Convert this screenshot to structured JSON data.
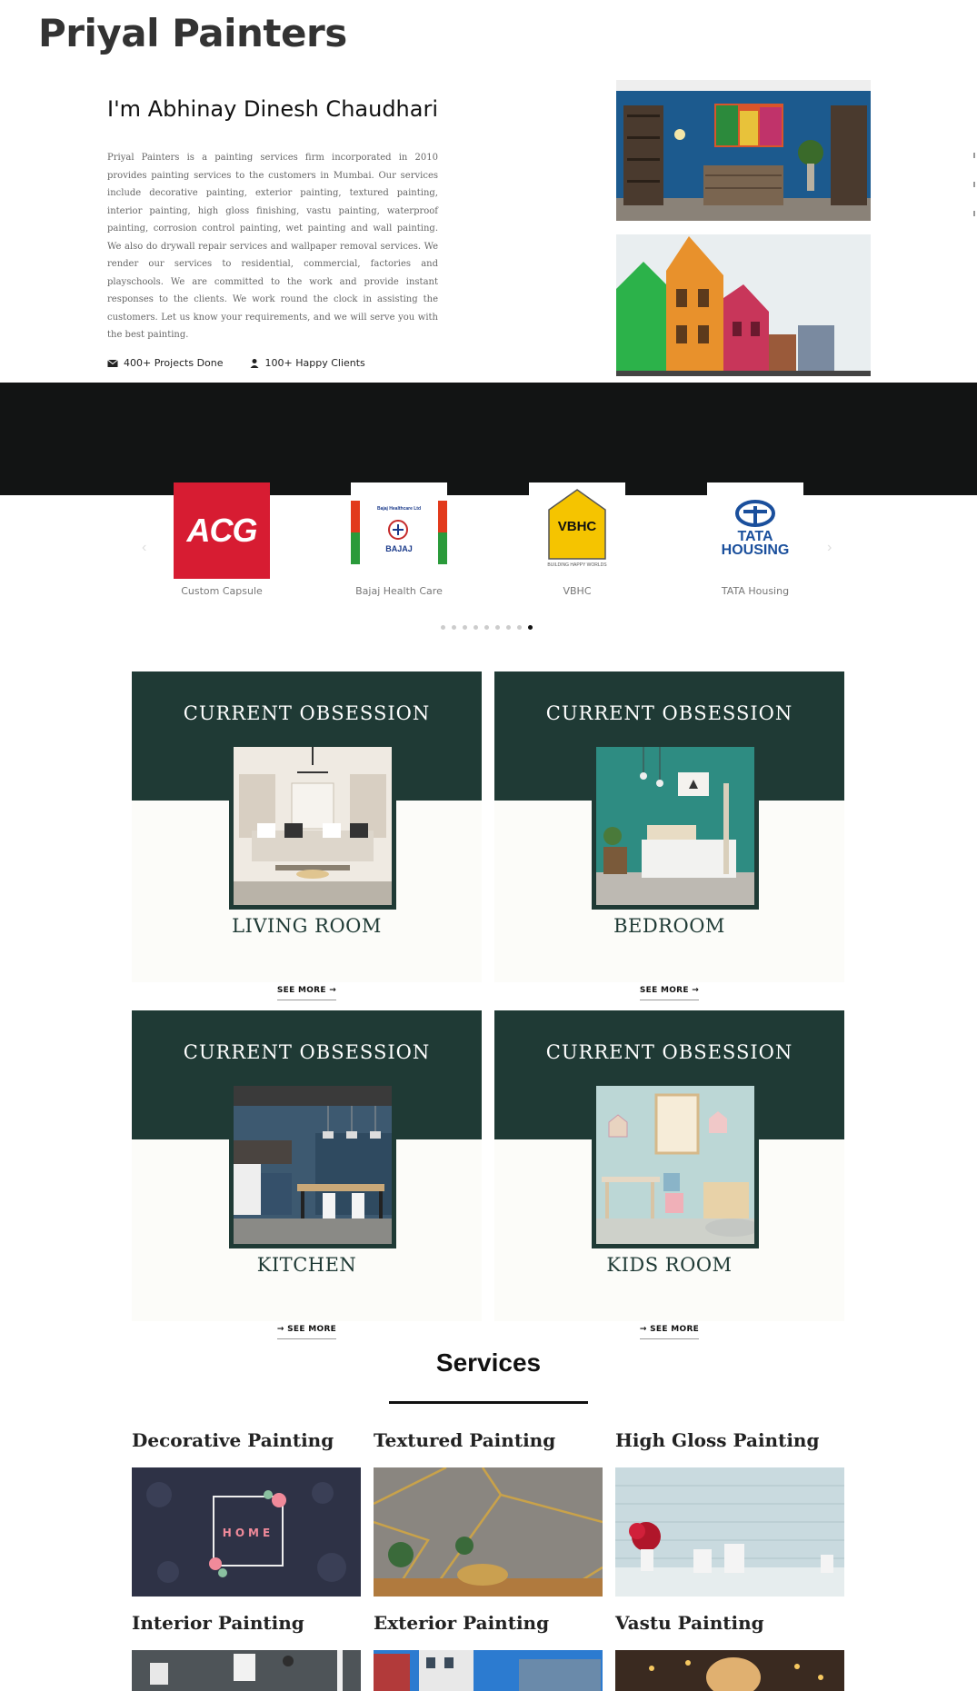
{
  "brand": "Priyal Painters",
  "about": {
    "heading": "I'm Abhinay Dinesh Chaudhari",
    "text": "Priyal Painters is a painting services firm incorporated in 2010 provides painting services to the customers in Mumbai. Our services include decorative painting, exterior painting, textured painting, interior painting, high gloss finishing, vastu painting, waterproof painting, corrosion control painting, wet painting and wall painting. We also do drywall repair services and wallpaper removal services. We render our services to residential, commercial, factories and playschools. We are committed to the work and provide instant responses to the clients. We work round the clock in assisting the customers. Let us know your requirements, and we will serve you with the best painting.",
    "stats": [
      {
        "icon": "envelope-icon",
        "label": "400+ Projects Done"
      },
      {
        "icon": "user-icon",
        "label": "100+ Happy Clients"
      }
    ]
  },
  "clients": [
    {
      "name": "Custom Capsule",
      "logo_text": "ACG",
      "color": "#d71c32"
    },
    {
      "name": "Bajaj Health Care",
      "logo_text": "BAJAJ",
      "logo_subtext": "Bajaj Healthcare Ltd"
    },
    {
      "name": "VBHC",
      "logo_text": "VBHC",
      "logo_subtext": "BUILDING HAPPY WORLDS",
      "color": "#f5c400"
    },
    {
      "name": "TATA Housing",
      "logo_text": "TATA",
      "logo_subtext": "HOUSING",
      "color": "#1a4f9c"
    }
  ],
  "carousel": {
    "dot_count": 9,
    "active_index": 8
  },
  "obsessions": {
    "heading": "CURRENT OBSESSION",
    "cards": [
      {
        "room": "LIVING ROOM",
        "cta": "SEE MORE →"
      },
      {
        "room": "BEDROOM",
        "cta": "SEE MORE →"
      },
      {
        "room": "KITCHEN",
        "cta": "→ SEE MORE"
      },
      {
        "room": "KIDS ROOM",
        "cta": "→ SEE MORE"
      }
    ]
  },
  "services": {
    "title": "Services",
    "items": [
      {
        "title": "Decorative Painting",
        "image_text": "HOME"
      },
      {
        "title": "Textured Painting"
      },
      {
        "title": "High Gloss Painting"
      },
      {
        "title": "Interior Painting"
      },
      {
        "title": "Exterior Painting"
      },
      {
        "title": "Vastu Painting"
      }
    ]
  },
  "colors": {
    "dark_green": "#1f3a35",
    "dark_band": "#121414",
    "card_bg": "#fcfcf9"
  }
}
